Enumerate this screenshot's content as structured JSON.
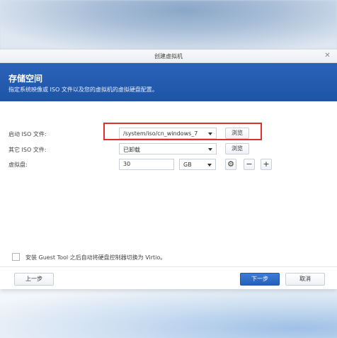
{
  "dialog": {
    "title": "创建虚拟机",
    "banner_title": "存储空间",
    "banner_subtitle": "指定系统映像或 ISO 文件以及您的虚拟机的虚拟硬盘配置。"
  },
  "form": {
    "boot_iso": {
      "label": "启动 ISO 文件:",
      "value": "/system/iso/cn_windows_7",
      "browse": "浏览"
    },
    "other_iso": {
      "label": "其它 ISO 文件:",
      "value": "已卸载",
      "browse": "浏览"
    },
    "vdisk": {
      "label": "虚拟盘:",
      "size": "30",
      "unit": "GB"
    }
  },
  "guest_tool": {
    "label": "安装 Guest Tool 之后自动将硬盘控制器切换为 Virtio。"
  },
  "footer": {
    "prev": "上一步",
    "next": "下一步",
    "cancel": "取消"
  },
  "colors": {
    "banner": "#1d54a6",
    "highlight": "#e0302e",
    "primary_button": "#2461bb"
  }
}
